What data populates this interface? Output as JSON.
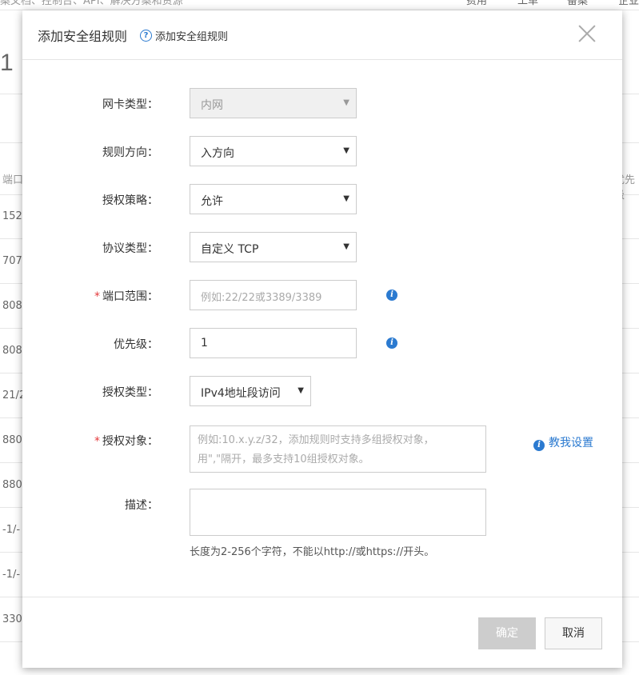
{
  "background": {
    "search_text": "案文档、控制台、API、解决方案和资源",
    "nav": [
      "费用",
      "工单",
      "备案",
      "企业"
    ],
    "title": "1",
    "col_port": "端口",
    "col_priority": "优先级",
    "rows": [
      "152",
      "707",
      "808",
      "808",
      "21/2",
      "880",
      "880",
      "-1/-",
      "-1/-",
      "330"
    ]
  },
  "dialog": {
    "title": "添加安全组规则",
    "help_icon": "?",
    "help_text": "添加安全组规则",
    "fields": {
      "nic_type": {
        "label": "网卡类型：",
        "value": "内网",
        "disabled": true
      },
      "direction": {
        "label": "规则方向：",
        "value": "入方向"
      },
      "policy": {
        "label": "授权策略：",
        "value": "允许"
      },
      "protocol": {
        "label": "协议类型：",
        "value": "自定义 TCP"
      },
      "port_range": {
        "label": "端口范围：",
        "required": true,
        "placeholder": "例如:22/22或3389/3389"
      },
      "priority": {
        "label": "优先级：",
        "value": "1"
      },
      "auth_type": {
        "label": "授权类型：",
        "value": "IPv4地址段访问"
      },
      "auth_object": {
        "label": "授权对象：",
        "required": true,
        "placeholder_line1": "例如:10.x.y.z/32，添加规则时支持多组授权对象，",
        "placeholder_line2": "用\",\"隔开，最多支持10组授权对象。"
      },
      "description": {
        "label": "描述：",
        "value": "",
        "hint": "长度为2-256个字符，不能以http://或https://开头。"
      }
    },
    "teach_link": "教我设置",
    "required_mark": "*",
    "arrow": "▼",
    "info_icon": "i",
    "ok_label": "确定",
    "cancel_label": "取消"
  },
  "colors": {
    "accent": "#2b7ad0",
    "required": "#e4393c",
    "ok_disabled": "#cdcdcd"
  }
}
